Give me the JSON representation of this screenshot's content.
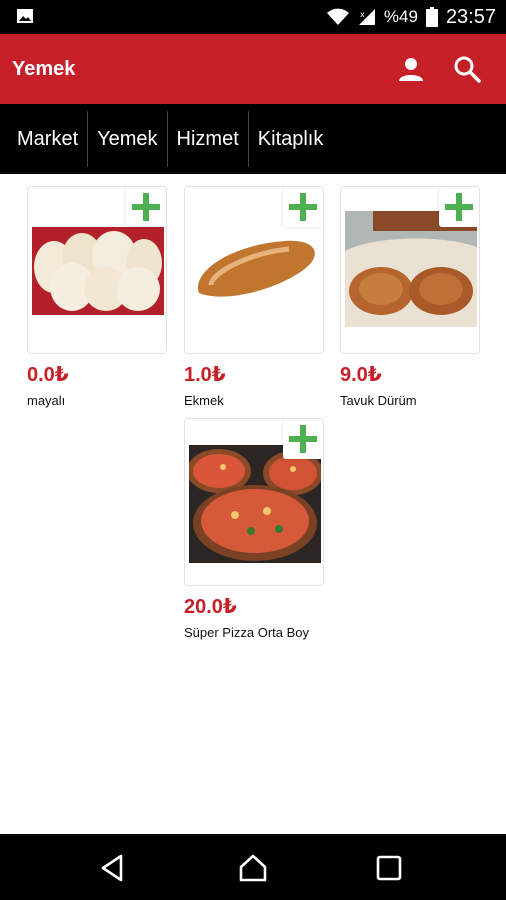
{
  "status": {
    "battery": "%49",
    "time": "23:57"
  },
  "appbar": {
    "title": "Yemek"
  },
  "tabs": [
    "Market",
    "Yemek",
    "Hizmet",
    "Kitaplık"
  ],
  "products": [
    {
      "price": "0.0₺",
      "name": "mayalı",
      "image": "flatbread-image"
    },
    {
      "price": "1.0₺",
      "name": "Ekmek",
      "image": "bread-image"
    },
    {
      "price": "9.0₺",
      "name": "Tavuk Dürüm",
      "image": "wrap-image"
    },
    {
      "price": "20.0₺",
      "name": "Süper Pizza Orta Boy",
      "image": "pizza-image"
    }
  ],
  "colors": {
    "brand": "#c62128",
    "add_green": "#4caf50"
  }
}
